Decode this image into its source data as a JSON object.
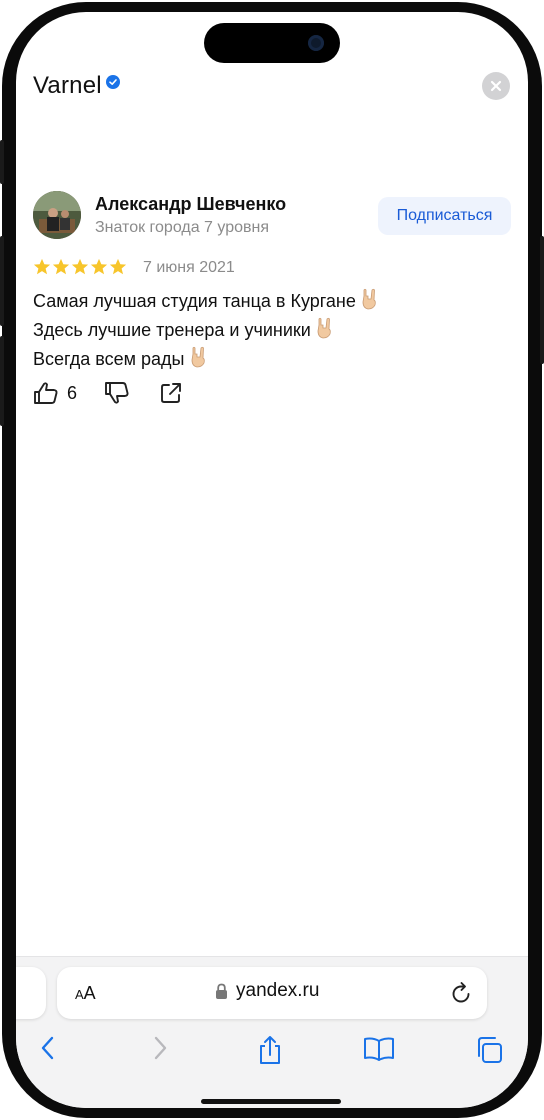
{
  "header": {
    "brand": "Varnel",
    "verified_icon": "verified-check-icon",
    "close_icon": "close-icon"
  },
  "review": {
    "author_name": "Александр Шевченко",
    "author_level": "Знаток города 7 уровня",
    "subscribe_label": "Подписаться",
    "rating": 5,
    "rating_max": 5,
    "date": "7 июня 2021",
    "text_lines": [
      "Самая лучшая студия танца в Кургане",
      "Здесь лучшие тренера и учиники",
      "Всегда всем рады"
    ],
    "likes": "6"
  },
  "browser": {
    "text_size_small": "A",
    "text_size_large": "A",
    "url": "yandex.ru",
    "toolbar": [
      "back-icon",
      "forward-icon",
      "share-icon",
      "bookmarks-icon",
      "tabs-icon"
    ]
  },
  "colors": {
    "accent": "#1a5bd6",
    "star": "#f7c52b",
    "muted": "#8b8b8b",
    "subscribe_bg": "#eef3fd"
  }
}
